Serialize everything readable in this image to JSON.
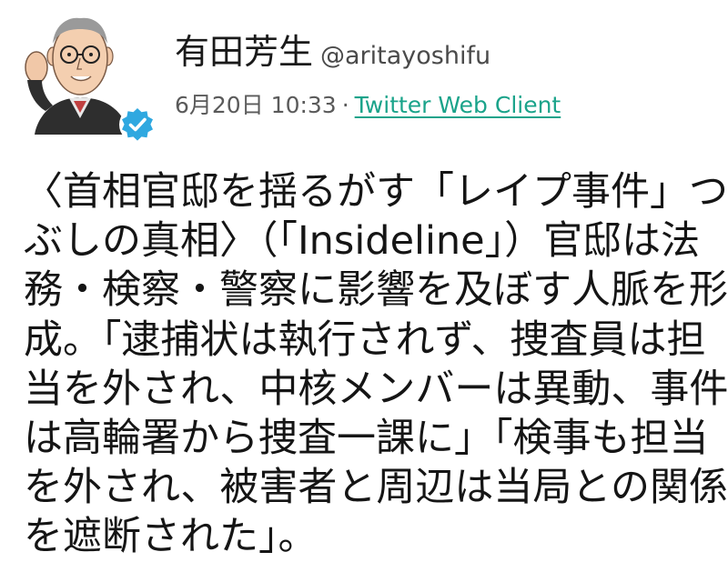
{
  "tweet": {
    "author": {
      "name": "有田芳生",
      "handle": "@aritayoshifu",
      "verified": true
    },
    "date": "6月20日",
    "time": "10:33",
    "separator": "·",
    "client": "Twitter Web Client",
    "body_lines": [
      "〈首相官邸を揺るがす「レイプ事件」つ",
      "ぶしの真相〉（「Insideline」）官邸は法",
      "務・検察・警察に影響を及ぼす人脈を形",
      "成。「逮捕状は執行されず、捜査員は担",
      "当を外され、中核メンバーは異動、事件",
      "は高輪署から捜査一課に」「検事も担当",
      "を外され、被害者と周辺は当局との関係",
      "を遮断された」。"
    ]
  },
  "colors": {
    "link": "#1aa38a",
    "verified": "#2fa8e0",
    "text": "#151515"
  },
  "icons": {
    "avatar": "caricature-avatar",
    "verified": "verified-badge-icon"
  }
}
